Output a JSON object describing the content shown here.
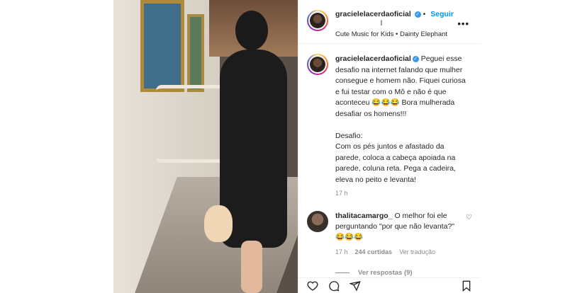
{
  "post": {
    "author": "gracielelacerdaoficial",
    "follow_label": "Seguir",
    "second_line": "l",
    "music": "Cute Music for Kids • Dainty Elephant",
    "caption": "Peguei esse desafio na internet falando que mulher consegue e homem não. Fiquei curiosa e fui testar com o Mô e não é que aconteceu 😂😂😂 Bora mulherada desafiar os homens!!!\n\nDesafio:\nCom os pés juntos e afastado da parede, coloca a cabeça apoiada na parede, coluna reta. Pega a cadeira, eleva no peito e levanta!",
    "caption_time": "17 h"
  },
  "comment": {
    "author": "thalitacamargo_",
    "text": "O melhor foi ele perguntando \"por que não levanta?\" 😂😂😂",
    "time": "17 h",
    "likes": "244 curtidas",
    "translate": "Ver tradução",
    "replies": "Ver respostas (9)"
  },
  "icons": {
    "verified": "verified-badge",
    "more": "more-options-icon",
    "heart": "heart-icon",
    "like": "like-icon",
    "comment": "comment-icon",
    "share": "share-icon",
    "save": "bookmark-icon"
  },
  "colors": {
    "follow": "#0095f6",
    "verified": "#3897f0",
    "muted": "#8e8e8e"
  }
}
